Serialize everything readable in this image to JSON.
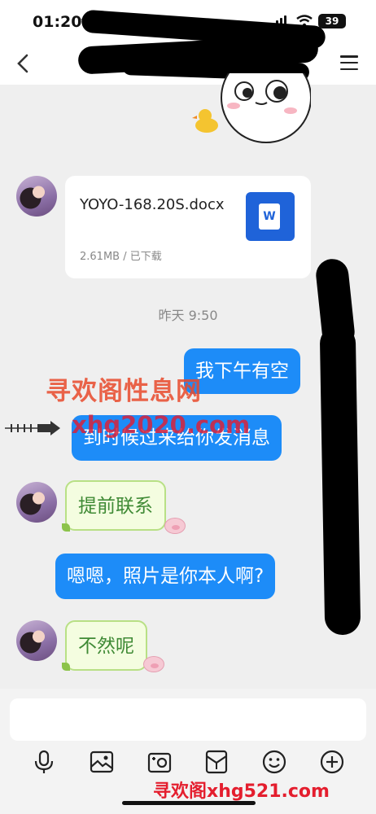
{
  "status_bar": {
    "time": "01:20",
    "battery": "39"
  },
  "header": {
    "title": ""
  },
  "messages": {
    "file": {
      "name": "YOYO-168.20S.docx",
      "meta": "2.61MB / 已下载",
      "icon_letter": "W"
    },
    "timestamp": "昨天 9:50",
    "out_1": "我下午有空",
    "out_2": "到时候过来给你发消息",
    "in_1": "提前联系",
    "out_3": "嗯嗯，照片是你本人啊?",
    "in_2": "不然呢"
  },
  "watermarks": {
    "line1": "寻欢阁性息网",
    "line2": "xhg2020.com",
    "footer": "寻欢阁xhg521.com"
  },
  "input": {
    "placeholder": ""
  },
  "toolbar": {
    "items": [
      "microphone-icon",
      "image-icon",
      "camera-icon",
      "red-packet-icon",
      "emoji-icon",
      "plus-icon"
    ]
  },
  "colors": {
    "accent": "#1d8cf8",
    "incoming_bg": "#f4fde0",
    "incoming_text": "#3f8a35",
    "file_icon": "#1f63d9"
  }
}
